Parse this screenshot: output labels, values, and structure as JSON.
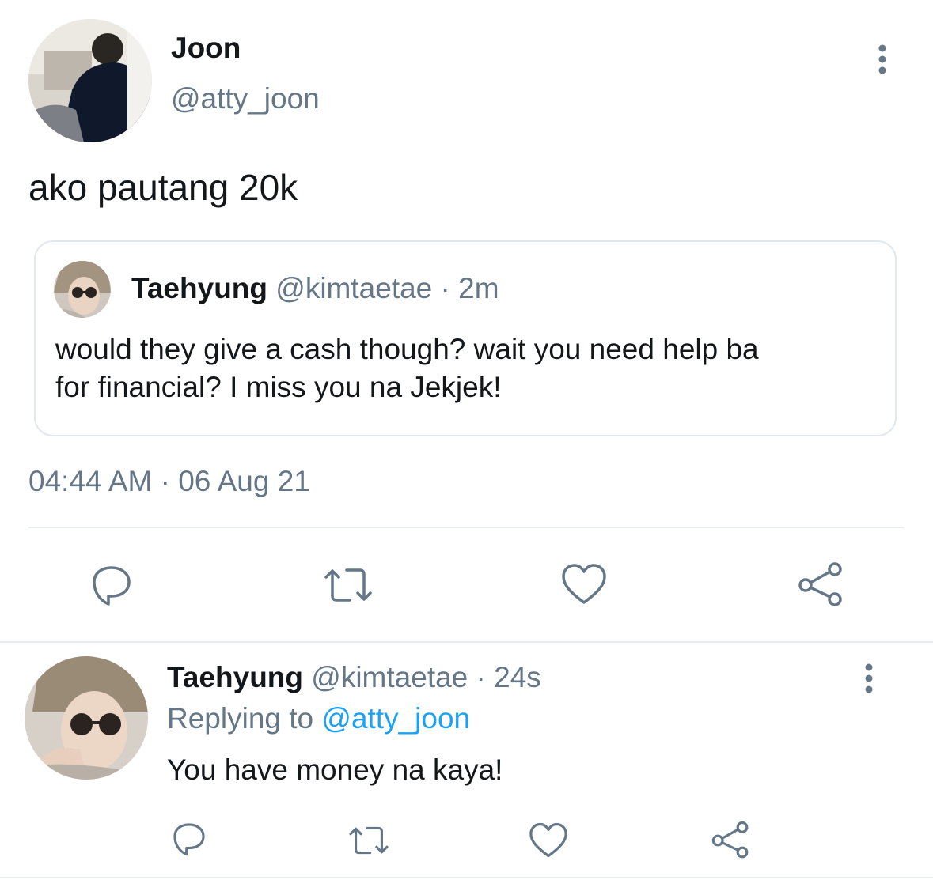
{
  "tweet": {
    "author": {
      "name": "Joon",
      "handle": "@atty_joon"
    },
    "text": "ako pautang 20k",
    "quoted": {
      "name": "Taehyung",
      "handle": "@kimtaetae",
      "time": "· 2m",
      "text_line1": "would they give a cash though? wait you need help ba",
      "text_line2": "for financial? I miss you na Jekjek!"
    },
    "timestamp": "04:44 AM · 06 Aug 21"
  },
  "reply": {
    "name": "Taehyung",
    "handle": "@kimtaetae",
    "time": "· 24s",
    "replying_prefix": "Replying to",
    "replying_handle": "@atty_joon",
    "text": "You have money na kaya!"
  },
  "colors": {
    "accent": "#1da1f2",
    "muted": "#657786",
    "text": "#14171a",
    "border": "#e1e8ed"
  },
  "icons": [
    "more-vertical-icon",
    "reply-icon",
    "retweet-icon",
    "like-icon",
    "share-icon"
  ]
}
